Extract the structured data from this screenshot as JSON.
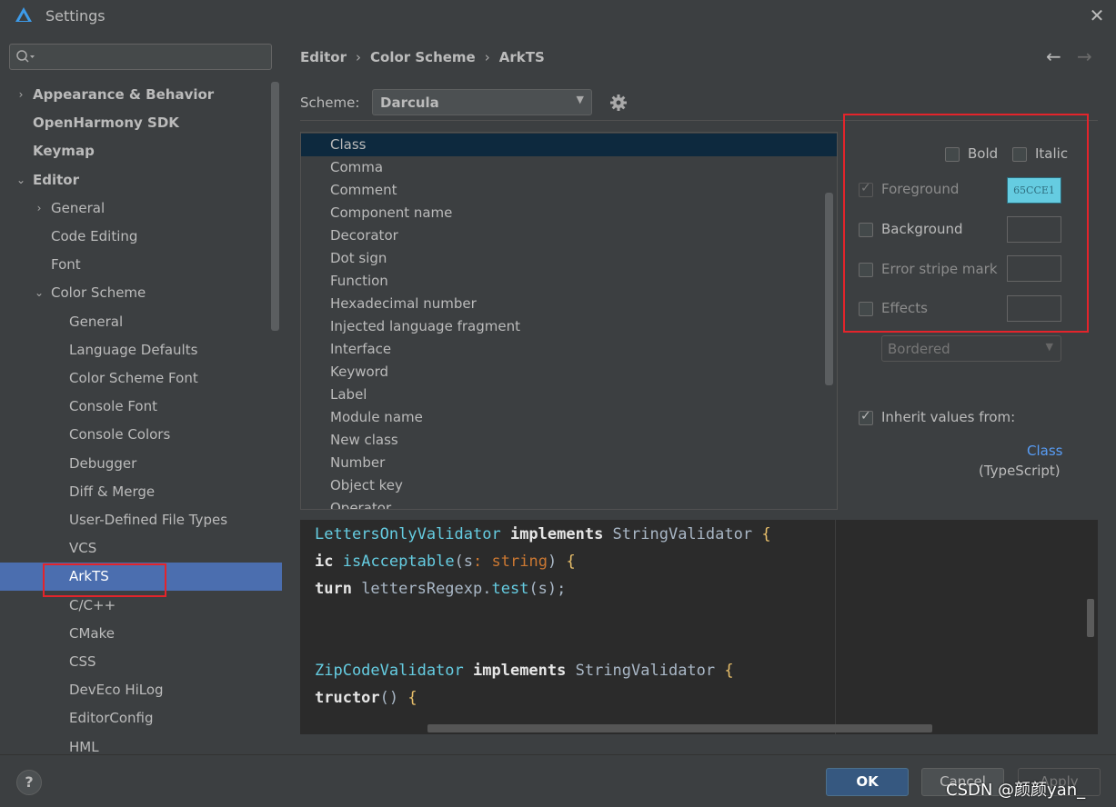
{
  "window": {
    "title": "Settings",
    "close_glyph": "✕"
  },
  "sidebar": {
    "search": {
      "value": "",
      "placeholder": ""
    },
    "items": [
      {
        "label": "Appearance & Behavior",
        "arrow": "›"
      },
      {
        "label": "OpenHarmony SDK",
        "arrow": ""
      },
      {
        "label": "Keymap",
        "arrow": ""
      },
      {
        "label": "Editor",
        "arrow": "⌄"
      },
      {
        "label": "General",
        "arrow": "›"
      },
      {
        "label": "Code Editing",
        "arrow": ""
      },
      {
        "label": "Font",
        "arrow": ""
      },
      {
        "label": "Color Scheme",
        "arrow": "⌄"
      },
      {
        "label": "General",
        "arrow": ""
      },
      {
        "label": "Language Defaults",
        "arrow": ""
      },
      {
        "label": "Color Scheme Font",
        "arrow": ""
      },
      {
        "label": "Console Font",
        "arrow": ""
      },
      {
        "label": "Console Colors",
        "arrow": ""
      },
      {
        "label": "Debugger",
        "arrow": ""
      },
      {
        "label": "Diff & Merge",
        "arrow": ""
      },
      {
        "label": "User-Defined File Types",
        "arrow": ""
      },
      {
        "label": "VCS",
        "arrow": ""
      },
      {
        "label": "ArkTS",
        "arrow": ""
      },
      {
        "label": "C/C++",
        "arrow": ""
      },
      {
        "label": "CMake",
        "arrow": ""
      },
      {
        "label": "CSS",
        "arrow": ""
      },
      {
        "label": "DevEco HiLog",
        "arrow": ""
      },
      {
        "label": "EditorConfig",
        "arrow": ""
      },
      {
        "label": "HML",
        "arrow": ""
      }
    ],
    "selected_item": "ArkTS"
  },
  "breadcrumb": {
    "items": [
      "Editor",
      "Color Scheme",
      "ArkTS"
    ],
    "separator": "›"
  },
  "nav": {
    "back_glyph": "←",
    "forward_glyph": "→"
  },
  "scheme": {
    "label": "Scheme:",
    "value": "Darcula",
    "caret": "▼"
  },
  "element_list": {
    "items": [
      "Class",
      "Comma",
      "Comment",
      "Component name",
      "Decorator",
      "Dot sign",
      "Function",
      "Hexadecimal number",
      "Injected language fragment",
      "Interface",
      "Keyword",
      "Label",
      "Module name",
      "New class",
      "Number",
      "Object key",
      "Operator"
    ],
    "selected": "Class"
  },
  "attributes": {
    "bold": {
      "label": "Bold",
      "checked": false
    },
    "italic": {
      "label": "Italic",
      "checked": false
    },
    "foreground": {
      "label": "Foreground",
      "checked": true,
      "color_text": "65CCE1",
      "color": "#65cce1"
    },
    "background": {
      "label": "Background",
      "checked": false
    },
    "error_stripe": {
      "label": "Error stripe mark",
      "checked": false
    },
    "effects": {
      "label": "Effects",
      "checked": false,
      "style": "Bordered",
      "caret": "▼"
    },
    "inherit": {
      "label": "Inherit values from:",
      "checked": true,
      "link": "Class",
      "source": "(TypeScript)"
    }
  },
  "preview": {
    "lines": [
      [
        [
          "cls",
          "LettersOnlyValidator"
        ],
        [
          "pl",
          " "
        ],
        [
          "kk",
          "implements"
        ],
        [
          "pl",
          " StringValidator "
        ],
        [
          "br",
          "{"
        ]
      ],
      [
        [
          "kk",
          "ic"
        ],
        [
          "pl",
          " "
        ],
        [
          "fn",
          "isAcceptable"
        ],
        [
          "pl",
          "(s"
        ],
        [
          "kw",
          ":"
        ],
        [
          "pl",
          " "
        ],
        [
          "kw",
          "string"
        ],
        [
          "pl",
          ") "
        ],
        [
          "br",
          "{"
        ]
      ],
      [
        [
          "kk",
          "turn"
        ],
        [
          "pl",
          " lettersRegexp."
        ],
        [
          "fn",
          "test"
        ],
        [
          "pl",
          "(s);"
        ]
      ],
      [],
      [],
      [
        [
          "cls",
          "ZipCodeValidator"
        ],
        [
          "pl",
          " "
        ],
        [
          "kk",
          "implements"
        ],
        [
          "pl",
          " StringValidator "
        ],
        [
          "br",
          "{"
        ]
      ],
      [
        [
          "kk",
          "tructor"
        ],
        [
          "pl",
          "() "
        ],
        [
          "br",
          "{"
        ]
      ]
    ]
  },
  "buttons": {
    "ok": "OK",
    "cancel": "Cancel",
    "apply": "Apply",
    "help": "?"
  },
  "watermark": "CSDN @颜颜yan_",
  "colors": {
    "accent": "#4b6eaf",
    "highlight_box": "#e3242b",
    "link": "#589df6",
    "ok": "#365880"
  }
}
